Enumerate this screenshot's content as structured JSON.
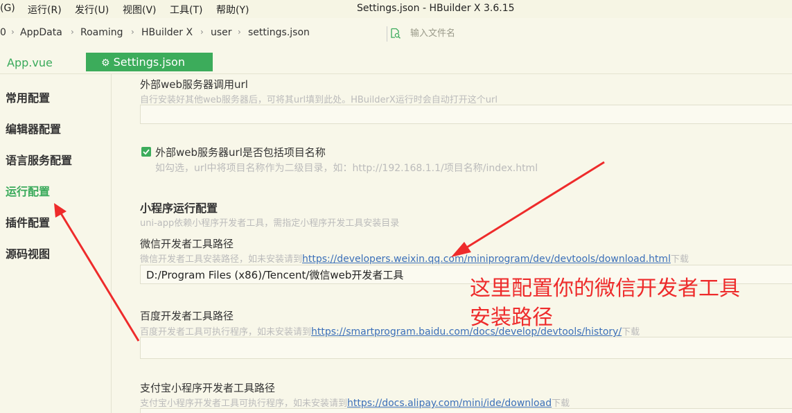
{
  "menubar": {
    "items": [
      "(G)",
      "运行(R)",
      "发行(U)",
      "视图(V)",
      "工具(T)",
      "帮助(Y)"
    ],
    "window_title": "Settings.json - HBuilder X 3.6.15"
  },
  "breadcrumb": {
    "items": [
      "0",
      "AppData",
      "Roaming",
      "HBuilder X",
      "user",
      "settings.json"
    ],
    "search_placeholder": "输入文件名"
  },
  "tabs": {
    "appvue": "App.vue",
    "settings": "Settings.json"
  },
  "sidebar": {
    "items": [
      {
        "label": "常用配置",
        "active": false
      },
      {
        "label": "编辑器配置",
        "active": false
      },
      {
        "label": "语言服务配置",
        "active": false
      },
      {
        "label": "运行配置",
        "active": true
      },
      {
        "label": "插件配置",
        "active": false
      },
      {
        "label": "源码视图",
        "active": false
      }
    ]
  },
  "main": {
    "web_server_url": {
      "label": "外部web服务器调用url",
      "desc": "自行安装好其他web服务器后，可将其url填到此处。HBuilderX运行时会自动打开这个url",
      "value": ""
    },
    "web_server_include_name": {
      "label": "外部web服务器url是否包括项目名称",
      "desc": "如勾选，url中将项目名称作为二级目录，如：http://192.168.1.1/项目名称/index.html",
      "checked": true
    },
    "miniprogram": {
      "title": "小程序运行配置",
      "desc": "uni-app依赖小程序开发者工具，需指定小程序开发工具安装目录"
    },
    "wechat": {
      "label": "微信开发者工具路径",
      "desc_prefix": "微信开发者工具安装路径，如未安装请到",
      "link": "https://developers.weixin.qq.com/miniprogram/dev/devtools/download.html",
      "desc_suffix": "下载",
      "value": "D:/Program Files (x86)/Tencent/微信web开发者工具"
    },
    "baidu": {
      "label": "百度开发者工具路径",
      "desc_prefix": "百度开发者工具可执行程序，如未安装请到",
      "link": "https://smartprogram.baidu.com/docs/develop/devtools/history/",
      "desc_suffix": "下载",
      "value": ""
    },
    "alipay": {
      "label": "支付宝小程序开发者工具路径",
      "desc_prefix": "支付宝小程序开发者工具可执行程序，如未安装请到",
      "link": "https://docs.alipay.com/mini/ide/download",
      "desc_suffix": "下载"
    }
  },
  "annotation": {
    "line1": "这里配置你的微信开发者工具",
    "line2": "安装路径",
    "color": "#ee2b2b"
  },
  "colors": {
    "accent": "#3cac5b",
    "background": "#f8f7e9",
    "link": "#3b6fb8"
  }
}
